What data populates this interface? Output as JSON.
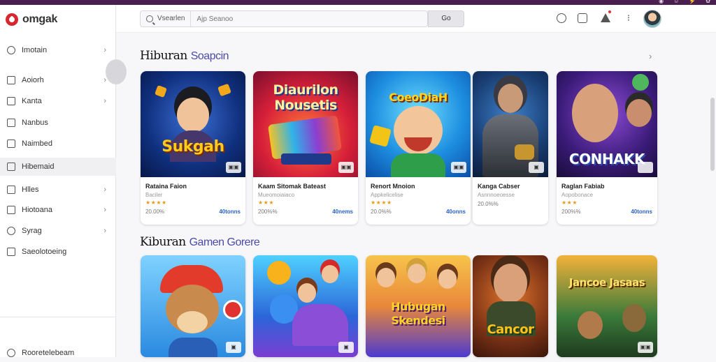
{
  "window": {
    "top_icons": [
      "◉",
      "☺",
      "⚡",
      "✿"
    ]
  },
  "app": {
    "name": "omgak"
  },
  "sidebar": {
    "items": [
      {
        "label": "Imotain",
        "has_chevron": true,
        "icon": "settings-icon"
      },
      {
        "label": "Aoiorh",
        "has_chevron": true,
        "icon": "document-icon"
      },
      {
        "label": "Kanta",
        "has_chevron": true,
        "icon": "list-icon"
      },
      {
        "label": "Nanbus",
        "has_chevron": false,
        "icon": "tag-icon"
      },
      {
        "label": "Naimbed",
        "has_chevron": false,
        "icon": "page-icon"
      },
      {
        "label": "Hibemaid",
        "has_chevron": false,
        "icon": "grid-icon",
        "active": true
      },
      {
        "label": "Hlles",
        "has_chevron": true,
        "icon": "file-icon"
      },
      {
        "label": "Hiotoana",
        "has_chevron": true,
        "icon": "bookmark-icon"
      },
      {
        "label": "Syrag",
        "has_chevron": true,
        "icon": "shield-icon"
      },
      {
        "label": "Saeolotoeing",
        "has_chevron": false,
        "icon": "page-icon"
      }
    ],
    "footer_label": "Rooretelebeam"
  },
  "header": {
    "search_scope": "Vsearlen",
    "search_placeholder": "Ajp Seanoo",
    "search_button": "Go"
  },
  "sections": [
    {
      "title": "Hiburan",
      "subtitle": "Soapcin",
      "games": [
        {
          "name": "Rataina Faion",
          "dev": "Baciler",
          "stars": "★★★★",
          "size": "20.00%",
          "price": "40tonns",
          "art_text": "Sukgah",
          "badge": "▣▣"
        },
        {
          "name": "Kaam Sitomak Bateast",
          "dev": "Mueomoiaiaco",
          "stars": "★★★",
          "size": "200%%",
          "price": "40nems",
          "art_text": "Diaurilon Nousetis",
          "badge": "▣▣"
        },
        {
          "name": "Renort Mnoion",
          "dev": "Appkelicelise",
          "stars": "★★★★",
          "size": "20.0%%",
          "price": "40onns",
          "art_text": "CoeoDiaH",
          "badge": "▣▣"
        },
        {
          "name": "Kanga Cabser",
          "dev": "Asnnnoeoesse",
          "stars": "",
          "size": "20.0%%",
          "price": "",
          "art_text": "",
          "badge": "▣"
        },
        {
          "name": "Raglan Fabiab",
          "dev": "Aopobonace",
          "stars": "★★★",
          "size": "200%%",
          "price": "40tonns",
          "art_text": "CONHAKK",
          "badge": ""
        }
      ]
    },
    {
      "title": "Kiburan",
      "subtitle": "Gamen Gorere",
      "games": [
        {
          "name": "",
          "dev": "",
          "stars": "",
          "size": "",
          "price": "",
          "art_text": "",
          "badge": "▣"
        },
        {
          "name": "",
          "dev": "",
          "stars": "",
          "size": "",
          "price": "",
          "art_text": "",
          "badge": "▣"
        },
        {
          "name": "",
          "dev": "",
          "stars": "",
          "size": "",
          "price": "",
          "art_text": "Hubugan Skendesi",
          "badge": ""
        },
        {
          "name": "",
          "dev": "",
          "stars": "",
          "size": "",
          "price": "",
          "art_text": "Cancor",
          "badge": ""
        },
        {
          "name": "",
          "dev": "",
          "stars": "",
          "size": "",
          "price": "",
          "art_text": "Jancoe Jasaas",
          "badge": "▣▣"
        }
      ]
    }
  ],
  "colors": {
    "top_strip": "#4a1f4f",
    "brand": "#d9252d",
    "price": "#2b63c6",
    "section_subtitle": "#4b4ba8",
    "stars": "#e89a1c"
  }
}
